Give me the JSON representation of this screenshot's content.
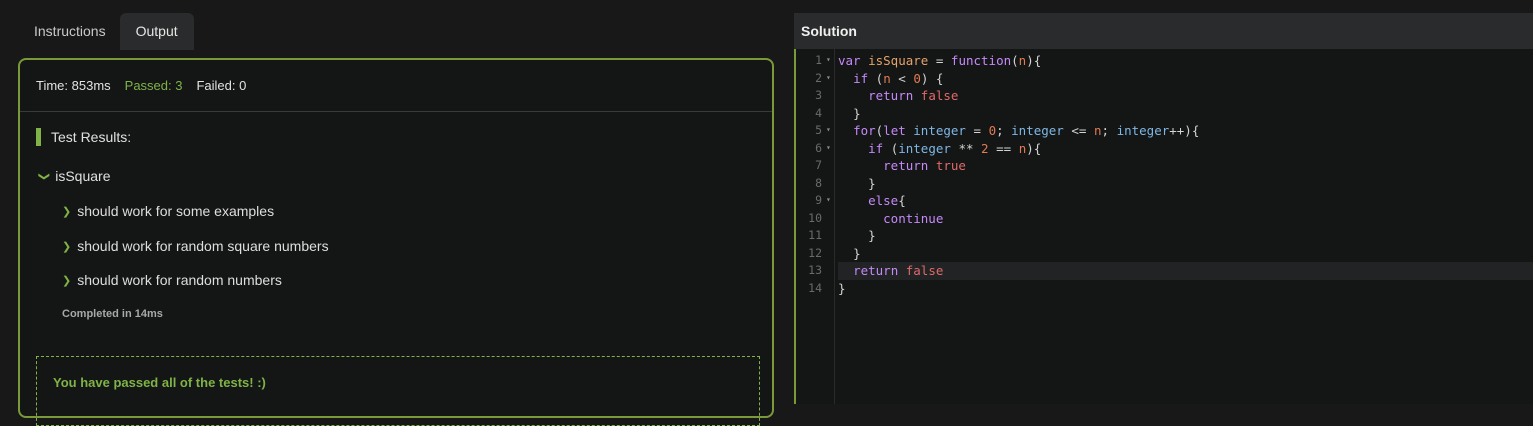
{
  "tabs": [
    {
      "label": "Instructions",
      "active": false
    },
    {
      "label": "Output",
      "active": true
    }
  ],
  "stats": {
    "time": "Time: 853ms",
    "passed": "Passed: 3",
    "failed": "Failed: 0"
  },
  "results_title": "Test Results:",
  "describe": "isSquare",
  "tests": [
    "should work for some examples",
    "should work for random square numbers",
    "should work for random numbers"
  ],
  "completed": "Completed in 14ms",
  "pass_message": "You have passed all of the tests! :)",
  "solution": {
    "title": "Solution",
    "line_numbers": [
      "1",
      "2",
      "3",
      "4",
      "5",
      "6",
      "7",
      "8",
      "9",
      "10",
      "11",
      "12",
      "13",
      "14"
    ],
    "folds": [
      "▾",
      "▾",
      "",
      "",
      "▾",
      "▾",
      "",
      "",
      "▾",
      "",
      "",
      "",
      "",
      ""
    ],
    "lines": [
      "var isSquare = function(n){",
      "  if (n < 0) {",
      "    return false",
      "  }",
      "  for(let integer = 0; integer <= n; integer++){",
      "    if (integer ** 2 == n){",
      "      return true",
      "    }",
      "    else{",
      "      continue",
      "    }",
      "  }",
      "  return false",
      "}"
    ]
  },
  "colors": {
    "accent_green": "#7fb347",
    "border_green": "#7a9a3a",
    "background": "#181818"
  }
}
